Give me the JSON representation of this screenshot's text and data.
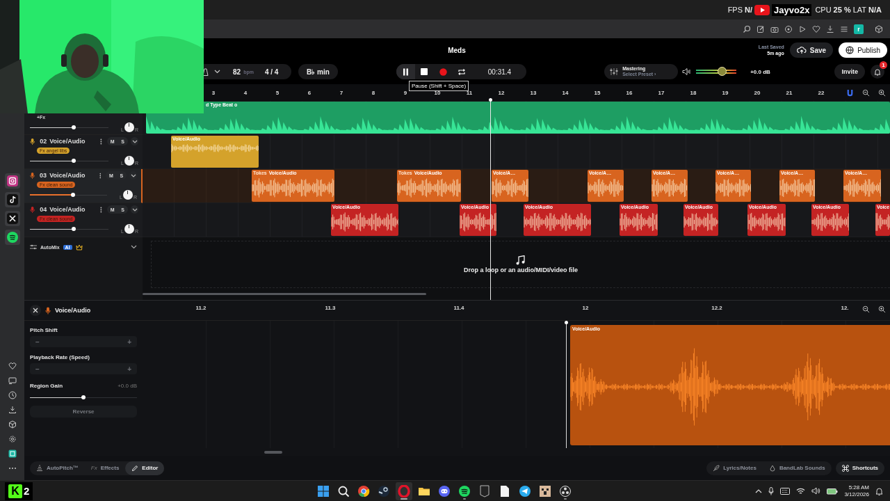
{
  "stream_overlay": {
    "fps_label": "FPS",
    "fps_value": "N/",
    "channel": "Jayvo2x",
    "cpu_label": "CPU",
    "cpu_value": "25 %",
    "lat_label": "LAT",
    "lat_value": "N/A"
  },
  "browser_toolbar": {
    "profile_initial": "r"
  },
  "header": {
    "title": "Meds",
    "bpm": "82",
    "bpm_unit": "bpm",
    "time_signature": "4 / 4",
    "key": "B♭ min",
    "time": "00:31.4",
    "playing": true,
    "tooltip": "Pause (Shift + Space)",
    "mastering": {
      "title": "Mastering",
      "preset": "Select Preset ›"
    },
    "master_volume": {
      "level": 0.65,
      "reading": "+0.0 dB"
    },
    "save_status": {
      "label": "Last Saved",
      "time": "5m ago"
    },
    "save_button": "Save",
    "publish_button": "Publish",
    "invite_button": "Invite",
    "notification_count": "1"
  },
  "ruler": [
    "3",
    "4",
    "5",
    "6",
    "7",
    "8",
    "9",
    "10",
    "11",
    "12",
    "13",
    "14",
    "15",
    "16",
    "17",
    "18",
    "19",
    "20",
    "21",
    "22"
  ],
  "tracks": [
    {
      "fx": {
        "kind": "add",
        "label": "+Fx"
      },
      "level": 0.56,
      "pan": {
        "left": "L",
        "right": "R"
      },
      "color": "#1e9e63",
      "selected": false,
      "clips": [
        {
          "label": "d Type Beat o"
        }
      ]
    },
    {
      "number": "02",
      "name": "Voice/Audio",
      "mute": "M",
      "solo": "S",
      "fx": {
        "kind": "effect",
        "label": "Fx angel libs"
      },
      "level": 0.56,
      "pan": {
        "left": "L",
        "right": "R"
      },
      "color": "#d4a22b",
      "selected": false,
      "clips": [
        {
          "label": "Voice/Audio"
        }
      ]
    },
    {
      "number": "03",
      "name": "Voice/Audio",
      "mute": "M",
      "solo": "S",
      "fx": {
        "kind": "effect",
        "label": "Fx clean sound"
      },
      "level": 0.56,
      "pan": {
        "left": "L",
        "right": "R"
      },
      "color": "#d8641f",
      "selected": true,
      "clips": [
        {
          "tag": "Tokes",
          "label": "Voice/Audio"
        },
        {
          "tag": "Tokes",
          "label": "Voice/Audio"
        },
        {
          "label": "Voice/A…"
        },
        {
          "label": "Voice/A…"
        },
        {
          "label": "Voice/A…"
        },
        {
          "label": "Voice/A…"
        },
        {
          "label": "Voice/A…"
        },
        {
          "label": "Voice/A…"
        }
      ]
    },
    {
      "number": "04",
      "name": "Voice/Audio",
      "mute": "M",
      "solo": "S",
      "fx": {
        "kind": "effect",
        "label": "Fx clean sound"
      },
      "level": 0.56,
      "pan": {
        "left": "L",
        "right": "R"
      },
      "color": "#c42323",
      "selected": false,
      "clips": [
        {
          "label": "Voice/Audio"
        },
        {
          "label": "Voice/Audio"
        },
        {
          "label": "Voice/Audio"
        },
        {
          "label": "Voice/Audio"
        },
        {
          "label": "Voice/Audio"
        },
        {
          "label": "Voice/Audio"
        },
        {
          "label": "Voice/Audio"
        },
        {
          "label": "Voice"
        }
      ]
    }
  ],
  "automix": {
    "label": "AutoMix",
    "badge": "AI"
  },
  "drop_zone": "Drop a loop or an audio/MIDI/video file",
  "editor": {
    "track_name": "Voice/Audio",
    "fields": [
      {
        "kind": "stepper",
        "label": "Pitch Shift",
        "minus": "−",
        "plus": "+",
        "disabled": true
      },
      {
        "kind": "stepper",
        "label": "Playback Rate (Speed)",
        "minus": "−",
        "plus": "+",
        "disabled": true
      },
      {
        "kind": "slider",
        "label": "Region Gain",
        "reading": "+0.0 dB",
        "level": 0.5
      }
    ],
    "reverse_button": {
      "label": "Reverse",
      "disabled": true
    },
    "ruler": [
      "11.2",
      "11.3",
      "11.4",
      "12",
      "12.2",
      "12."
    ],
    "clip_label": "Voice/Audio"
  },
  "bottom_tabs": [
    {
      "label": "AutoPitch™",
      "selected": false
    },
    {
      "icon_text": "Fx",
      "label": "Effects",
      "selected": false
    },
    {
      "label": "Editor",
      "selected": true
    }
  ],
  "right_tabs": [
    {
      "label": "Lyrics/Notes"
    },
    {
      "label": "BandLab Sounds"
    }
  ],
  "shortcuts_button": "Shortcuts",
  "taskbar": {
    "logo": "K",
    "logo_badge": "2",
    "apps": [
      {
        "kind": "windows",
        "active": false,
        "running": false
      },
      {
        "kind": "search",
        "active": false,
        "running": false
      },
      {
        "kind": "chrome",
        "active": false,
        "running": false
      },
      {
        "kind": "steam",
        "active": false,
        "running": false
      },
      {
        "kind": "opera",
        "active": true,
        "running": true
      },
      {
        "kind": "files",
        "active": false,
        "running": false
      },
      {
        "kind": "discord",
        "active": false,
        "running": false
      },
      {
        "kind": "spotify",
        "active": false,
        "running": true
      },
      {
        "kind": "epic",
        "active": false,
        "running": false
      },
      {
        "kind": "document",
        "active": false,
        "running": false
      },
      {
        "kind": "telegram",
        "active": false,
        "running": false
      },
      {
        "kind": "minecraft",
        "active": false,
        "running": false
      },
      {
        "kind": "obs",
        "active": false,
        "running": true
      }
    ],
    "time": "5:28 AM",
    "date": "3/12/2026"
  }
}
